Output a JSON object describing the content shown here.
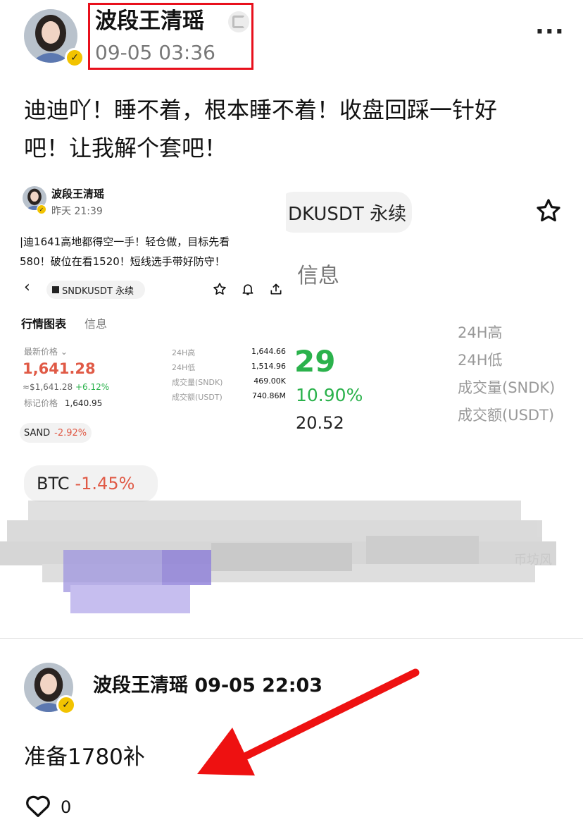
{
  "post": {
    "author": "波段王清瑶",
    "timestamp": "09-05 03:36",
    "content_line1": "迪迪吖！睡不着，根本睡不着！收盘回踩一针好",
    "content_line2": "吧！让我解个套吧！"
  },
  "embedded": {
    "author": "波段王清瑶",
    "timestamp": "昨天 21:39",
    "text_line1": "|迪1641高地都得空一手！轻仓做，目标先看",
    "text_line2": "580！破位在看1520！短线选手带好防守！",
    "symbol": "SNDKUSDT 永续",
    "tabs": [
      "行情图表",
      "信息"
    ],
    "latest_price_label": "最新价格",
    "price": "1,641.28",
    "price_usd": "≈$1,641.28",
    "change": "+6.12%",
    "mark_label": "标记价格",
    "mark_price": "1,640.95",
    "stats": [
      {
        "label": "24H高",
        "value": "1,644.66"
      },
      {
        "label": "24H低",
        "value": "1,514.96"
      },
      {
        "label": "成交量(SNDK)",
        "value": "469.00K"
      },
      {
        "label": "成交额(USDT)",
        "value": "740.86M"
      }
    ],
    "tag": "SAND",
    "tag_change": "-2.92%"
  },
  "background_panel": {
    "symbol": "DKUSDT 永续",
    "info_tab": "信息",
    "price_fragment": "29",
    "change_fragment": "10.90%",
    "mark_fragment": "20.52",
    "stats": [
      "24H高",
      "24H低",
      "成交量(SNDK)",
      "成交额(USDT)"
    ],
    "tag": "BTC",
    "tag_change": "-1.45%",
    "watermark": "币坊风"
  },
  "reply": {
    "author_time": "波段王清瑶 09-05 22:03",
    "content": "准备1780补",
    "likes": "0"
  },
  "colors": {
    "green": "#2bb24c",
    "red": "#e05a46",
    "highlight_box": "#e8101c",
    "arrow": "#ee1111"
  }
}
